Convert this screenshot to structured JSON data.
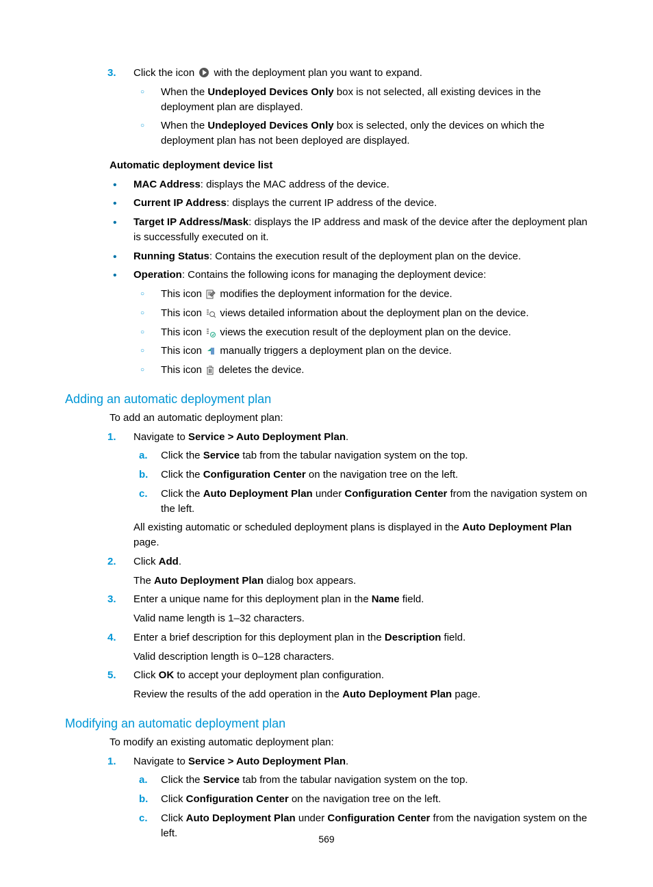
{
  "page_number": "569",
  "step3": {
    "num": "3.",
    "pre": "Click the icon ",
    "post": " with the deployment plan you want to expand.",
    "sub1_pre": "When the ",
    "sub1_bold": "Undeployed Devices Only",
    "sub1_post": " box is not selected, all existing devices in the deployment plan are displayed.",
    "sub2_pre": "When the ",
    "sub2_bold": "Undeployed Devices Only",
    "sub2_post": " box is selected, only the devices on which the deployment plan has not been deployed are displayed."
  },
  "auto_list_heading": "Automatic deployment device list",
  "auto_list_items": {
    "a": {
      "bold": "MAC Address",
      "post": ": displays the MAC address of the device."
    },
    "b": {
      "bold": "Current IP Address",
      "post": ": displays the current IP address of the device."
    },
    "c": {
      "bold": "Target IP Address/Mask",
      "post": ": displays the IP address and mask of the device after the deployment plan is successfully executed on it."
    },
    "d": {
      "bold": "Running Status",
      "post": ": Contains the execution result of the deployment plan on the device."
    },
    "e": {
      "bold": "Operation",
      "post": ": Contains the following icons for managing the deployment device:"
    }
  },
  "op_icons": {
    "a_pre": "This icon",
    "a_post": " modifies the deployment information for the device.",
    "b_pre": "This icon ",
    "b_post": " views detailed information about the deployment plan on the device.",
    "c_pre": "This icon ",
    "c_post": " views the execution result of the deployment plan on the device.",
    "d_pre": "This icon ",
    "d_post": " manually triggers a deployment plan on the device.",
    "e_pre": "This icon ",
    "e_post": " deletes the device."
  },
  "add_heading": "Adding an automatic deployment plan",
  "add_intro": "To add an automatic deployment plan:",
  "add_steps": {
    "s1": {
      "num": "1.",
      "pre": "Navigate to ",
      "bold": "Service > Auto Deployment Plan",
      "post": ".",
      "a": {
        "alpha": "a.",
        "pre": "Click the ",
        "bold": "Service",
        "post": " tab from the tabular navigation system on the top."
      },
      "b": {
        "alpha": "b.",
        "pre": "Click the ",
        "bold": "Configuration Center",
        "post": " on the navigation tree on the left."
      },
      "c": {
        "alpha": "c.",
        "pre": "Click the ",
        "bold1": "Auto Deployment Plan",
        "mid": " under ",
        "bold2": "Configuration Center",
        "post": " from the navigation system on the left."
      },
      "after_pre": "All existing automatic or scheduled deployment plans is displayed in the ",
      "after_bold": "Auto Deployment Plan",
      "after_post": " page."
    },
    "s2": {
      "num": "2.",
      "pre": "Click ",
      "bold": "Add",
      "post": ".",
      "after_pre": "The ",
      "after_bold": "Auto Deployment Plan",
      "after_post": " dialog box appears."
    },
    "s3": {
      "num": "3.",
      "pre": "Enter a unique name for this deployment plan in the ",
      "bold": "Name",
      "post": " field.",
      "after": "Valid name length is 1–32 characters."
    },
    "s4": {
      "num": "4.",
      "pre": "Enter a brief description for this deployment plan in the ",
      "bold": "Description",
      "post": " field.",
      "after": "Valid description length is 0–128 characters."
    },
    "s5": {
      "num": "5.",
      "pre": "Click ",
      "bold": "OK",
      "post": " to accept your deployment plan configuration.",
      "after_pre": "Review the results of the add operation in the ",
      "after_bold": "Auto Deployment Plan",
      "after_post": " page."
    }
  },
  "mod_heading": "Modifying an automatic deployment plan",
  "mod_intro": "To modify an existing automatic deployment plan:",
  "mod_steps": {
    "s1": {
      "num": "1.",
      "pre": "Navigate to ",
      "bold": "Service > Auto Deployment Plan",
      "post": ".",
      "a": {
        "alpha": "a.",
        "pre": "Click the ",
        "bold": "Service",
        "post": " tab from the tabular navigation system on the top."
      },
      "b": {
        "alpha": "b.",
        "pre": "Click ",
        "bold": "Configuration Center",
        "post": " on the navigation tree on the left."
      },
      "c": {
        "alpha": "c.",
        "pre": "Click ",
        "bold1": "Auto Deployment Plan",
        "mid": " under ",
        "bold2": "Configuration Center",
        "post": " from the navigation system on the left."
      }
    }
  }
}
